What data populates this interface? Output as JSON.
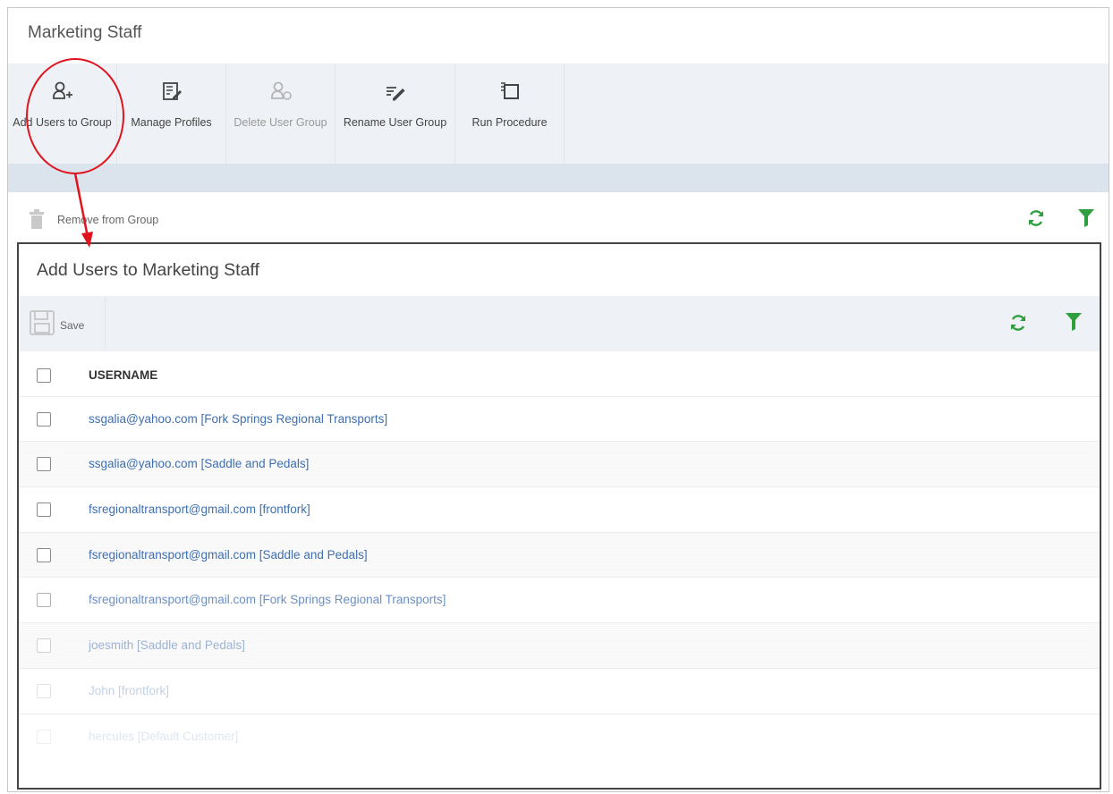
{
  "page": {
    "title": "Marketing Staff"
  },
  "toolbar": {
    "buttons": [
      {
        "label": "Add Users to Group",
        "icon": "add-user-icon",
        "disabled": false
      },
      {
        "label": "Manage Profiles",
        "icon": "edit-profile-icon",
        "disabled": false
      },
      {
        "label": "Delete User Group",
        "icon": "delete-group-icon",
        "disabled": true
      },
      {
        "label": "Rename User Group",
        "icon": "rename-pen-icon",
        "disabled": false
      },
      {
        "label": "Run Procedure",
        "icon": "run-procedure-icon",
        "disabled": false
      }
    ]
  },
  "actions": {
    "remove_label": "Remove from Group",
    "refresh_icon": "refresh-icon",
    "filter_icon": "filter-icon"
  },
  "dialog": {
    "title": "Add Users to Marketing Staff",
    "save_label": "Save",
    "column_header": "USERNAME",
    "rows": [
      "ssgalia@yahoo.com [Fork Springs Regional Transports]",
      "ssgalia@yahoo.com [Saddle and Pedals]",
      "fsregionaltransport@gmail.com [frontfork]",
      "fsregionaltransport@gmail.com [Saddle and Pedals]",
      "fsregionaltransport@gmail.com [Fork Springs Regional Transports]",
      "joesmith [Saddle and Pedals]",
      "John [frontfork]",
      "hercules [Default Customer]"
    ]
  },
  "colors": {
    "accent_green": "#2e9e3e",
    "link_blue": "#3d6fb2",
    "annotation_red": "#e0141e",
    "toolbar_bg": "#eef1f5"
  }
}
